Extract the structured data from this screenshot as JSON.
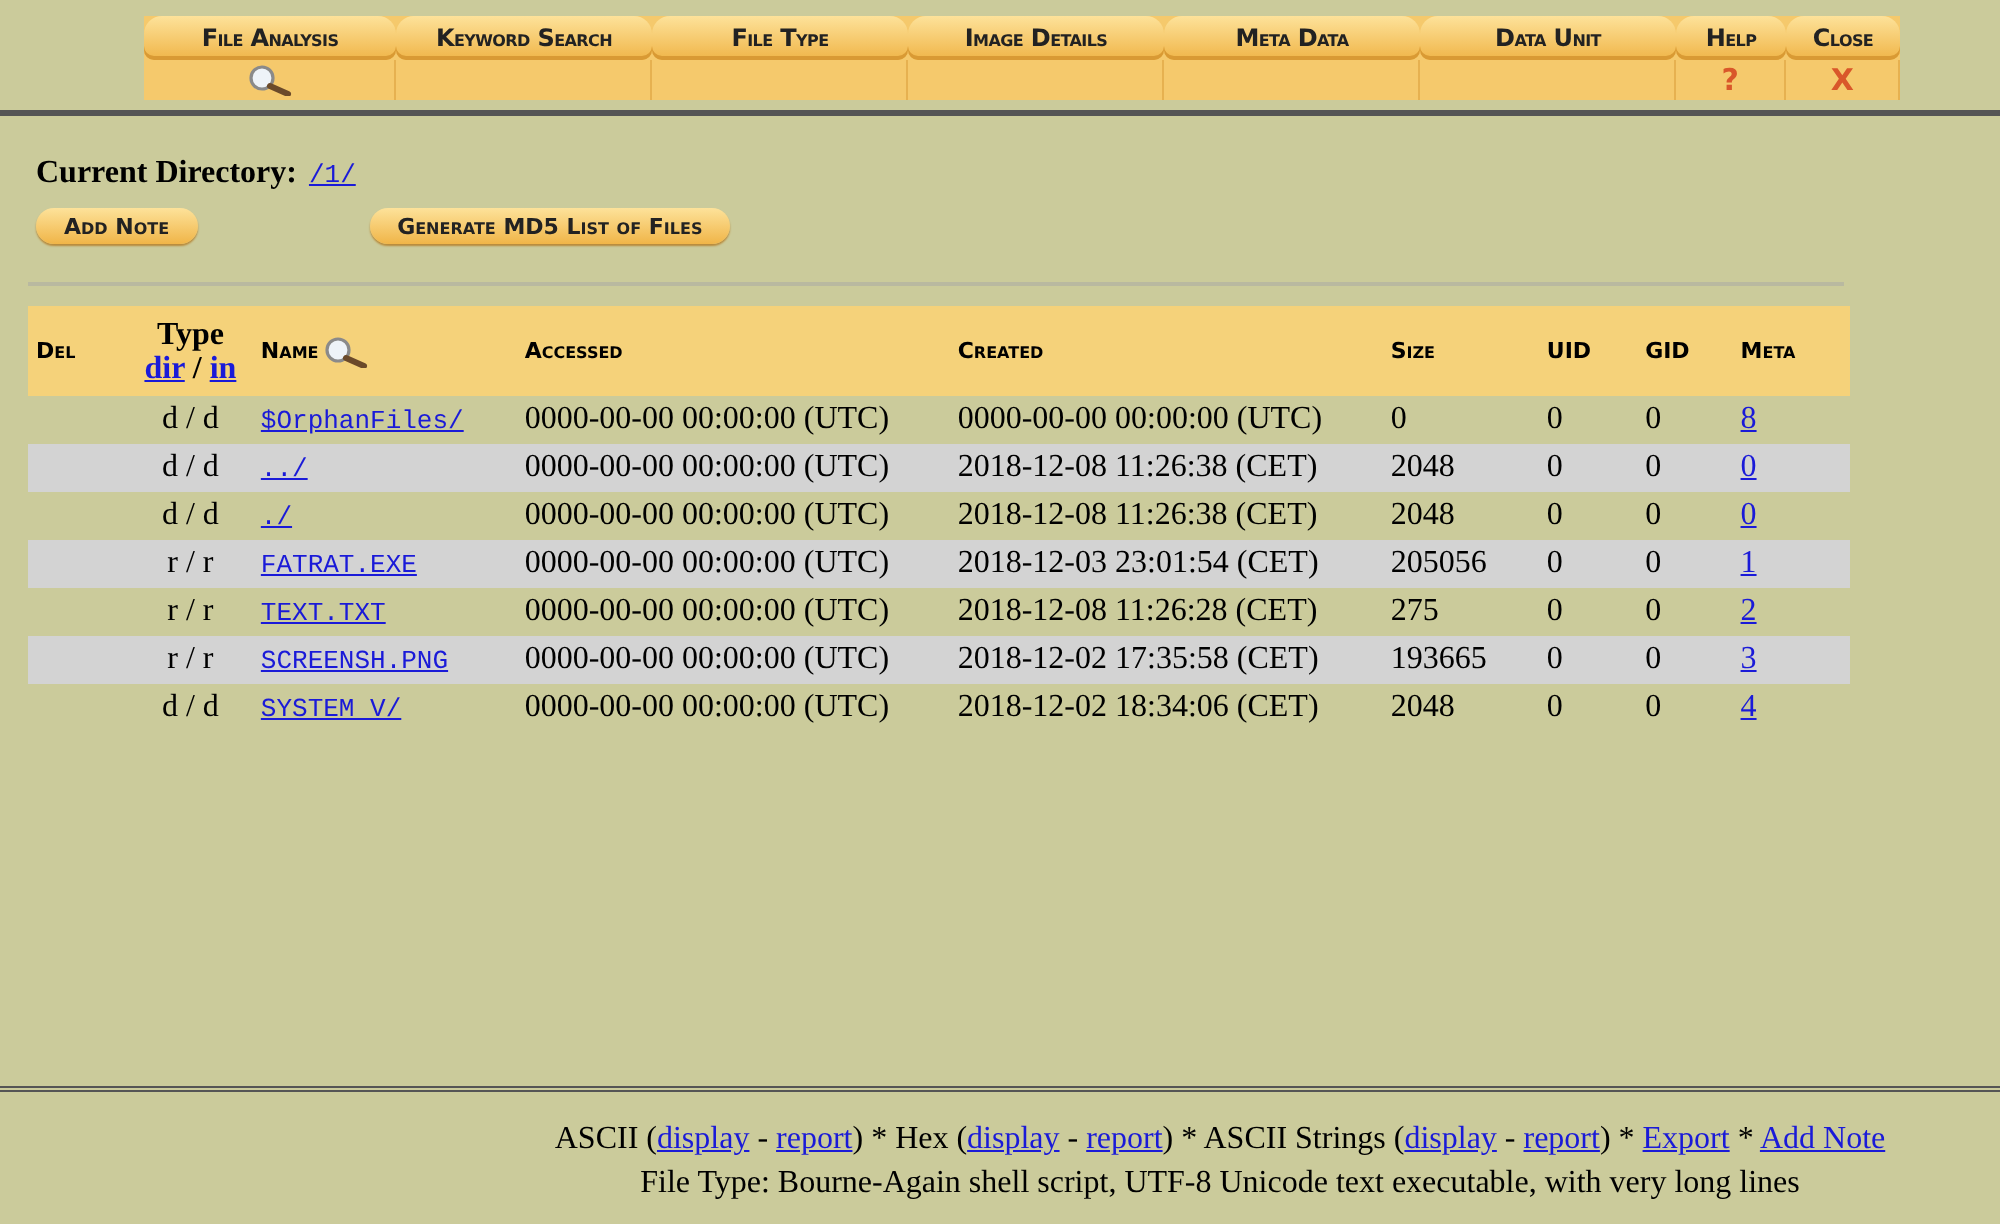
{
  "toolbar": {
    "tabs": [
      {
        "label": "File Analysis",
        "kind": "search"
      },
      {
        "label": "Keyword Search",
        "kind": "plain"
      },
      {
        "label": "File Type",
        "kind": "plain"
      },
      {
        "label": "Image Details",
        "kind": "plain"
      },
      {
        "label": "Meta Data",
        "kind": "plain"
      },
      {
        "label": "Data Unit",
        "kind": "plain"
      }
    ],
    "actions": [
      {
        "label": "Help",
        "symbol": "?"
      },
      {
        "label": "Close",
        "symbol": "X"
      }
    ]
  },
  "directory": {
    "label": "Current Directory:",
    "path": "/1/"
  },
  "buttons": [
    "Add Note",
    "Generate MD5 List of Files"
  ],
  "table": {
    "columns": [
      "Del",
      "Type",
      "Name",
      "Accessed",
      "Created",
      "Size",
      "UID",
      "GID",
      "Meta"
    ],
    "type_sort": [
      "dir",
      "/",
      "in"
    ],
    "rows": [
      {
        "type": "d / d",
        "name": "$OrphanFiles/",
        "accessed": "0000-00-00 00:00:00 (UTC)",
        "created": "0000-00-00 00:00:00 (UTC)",
        "size": "0",
        "uid": "0",
        "gid": "0",
        "meta": "8"
      },
      {
        "type": "d / d",
        "name": "../",
        "accessed": "0000-00-00 00:00:00 (UTC)",
        "created": "2018-12-08 11:26:38 (CET)",
        "size": "2048",
        "uid": "0",
        "gid": "0",
        "meta": "0"
      },
      {
        "type": "d / d",
        "name": "./",
        "accessed": "0000-00-00 00:00:00 (UTC)",
        "created": "2018-12-08 11:26:38 (CET)",
        "size": "2048",
        "uid": "0",
        "gid": "0",
        "meta": "0"
      },
      {
        "type": "r / r",
        "name": "FATRAT.EXE",
        "accessed": "0000-00-00 00:00:00 (UTC)",
        "created": "2018-12-03 23:01:54 (CET)",
        "size": "205056",
        "uid": "0",
        "gid": "0",
        "meta": "1"
      },
      {
        "type": "r / r",
        "name": "TEXT.TXT",
        "accessed": "0000-00-00 00:00:00 (UTC)",
        "created": "2018-12-08 11:26:28 (CET)",
        "size": "275",
        "uid": "0",
        "gid": "0",
        "meta": "2"
      },
      {
        "type": "r / r",
        "name": "SCREENSH.PNG",
        "accessed": "0000-00-00 00:00:00 (UTC)",
        "created": "2018-12-02 17:35:58 (CET)",
        "size": "193665",
        "uid": "0",
        "gid": "0",
        "meta": "3"
      },
      {
        "type": "d / d",
        "name": "SYSTEM V/",
        "accessed": "0000-00-00 00:00:00 (UTC)",
        "created": "2018-12-02 18:34:06 (CET)",
        "size": "2048",
        "uid": "0",
        "gid": "0",
        "meta": "4"
      }
    ]
  },
  "footer": {
    "options": [
      {
        "kind": "text",
        "text": "ASCII ("
      },
      {
        "kind": "link",
        "text": "display"
      },
      {
        "kind": "text",
        "text": " - "
      },
      {
        "kind": "link",
        "text": "report"
      },
      {
        "kind": "text",
        "text": ") * Hex ("
      },
      {
        "kind": "link",
        "text": "display"
      },
      {
        "kind": "text",
        "text": " - "
      },
      {
        "kind": "link",
        "text": "report"
      },
      {
        "kind": "text",
        "text": ") * ASCII Strings ("
      },
      {
        "kind": "link",
        "text": "display"
      },
      {
        "kind": "text",
        "text": " - "
      },
      {
        "kind": "link",
        "text": "report"
      },
      {
        "kind": "text",
        "text": ") * "
      },
      {
        "kind": "link",
        "text": "Export"
      },
      {
        "kind": "text",
        "text": " * "
      },
      {
        "kind": "link",
        "text": "Add Note"
      }
    ],
    "file_type": "File Type: Bourne-Again shell script, UTF-8 Unicode text executable, with very long lines"
  }
}
